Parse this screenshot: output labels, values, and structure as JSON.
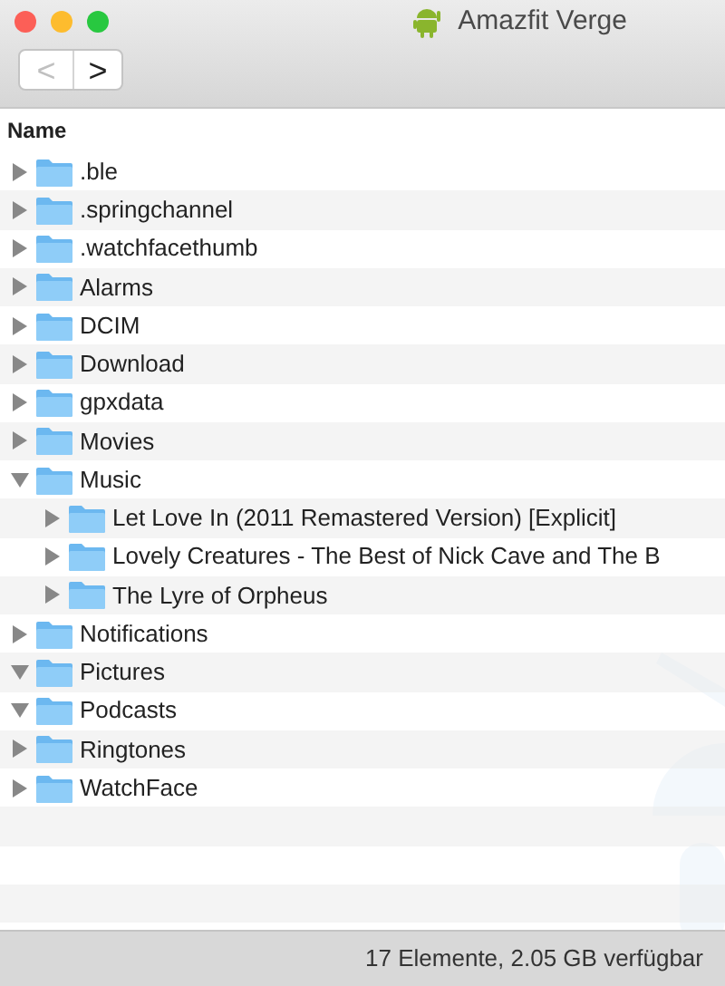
{
  "window": {
    "title": "Amazfit Verge"
  },
  "toolbar": {
    "back": {
      "label": "<",
      "disabled": true
    },
    "forward": {
      "label": ">",
      "disabled": false
    }
  },
  "list": {
    "column": "Name",
    "items": [
      {
        "name": ".ble",
        "expanded": false
      },
      {
        "name": ".springchannel",
        "expanded": false
      },
      {
        "name": ".watchfacethumb",
        "expanded": false
      },
      {
        "name": "Alarms",
        "expanded": false
      },
      {
        "name": "DCIM",
        "expanded": false
      },
      {
        "name": "Download",
        "expanded": false
      },
      {
        "name": "gpxdata",
        "expanded": false
      },
      {
        "name": "Movies",
        "expanded": false
      },
      {
        "name": "Music",
        "expanded": true,
        "children": [
          {
            "name": "Let Love In (2011 Remastered Version) [Explicit]",
            "expanded": false
          },
          {
            "name": "Lovely Creatures - The Best of Nick Cave and The B",
            "expanded": false
          },
          {
            "name": "The Lyre of Orpheus",
            "expanded": false
          }
        ]
      },
      {
        "name": "Notifications",
        "expanded": false
      },
      {
        "name": "Pictures",
        "expanded": true
      },
      {
        "name": "Podcasts",
        "expanded": true
      },
      {
        "name": "Ringtones",
        "expanded": false
      },
      {
        "name": "WatchFace",
        "expanded": false
      }
    ]
  },
  "status_bar": "17 Elemente, 2.05 GB verfügbar"
}
